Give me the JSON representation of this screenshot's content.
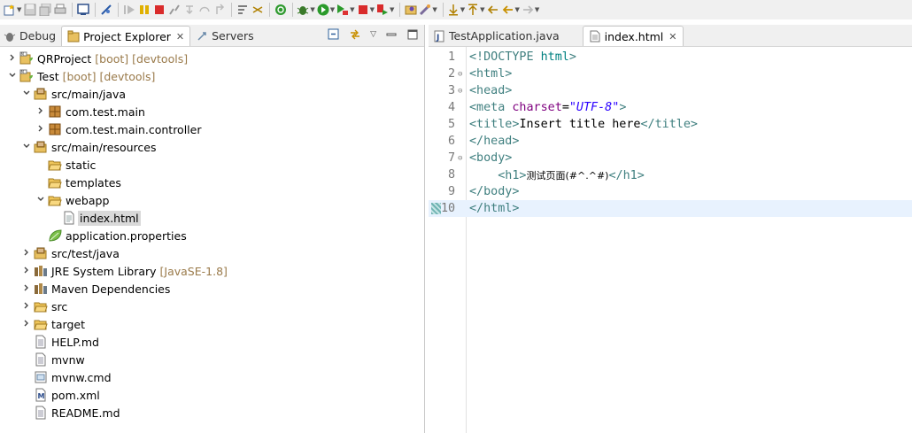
{
  "left_tabs": [
    {
      "label": "Debug",
      "icon": "debug-icon",
      "active": false
    },
    {
      "label": "Project Explorer",
      "icon": "project-explorer-icon",
      "active": true
    },
    {
      "label": "Servers",
      "icon": "servers-icon",
      "active": false
    }
  ],
  "left_close": "✕",
  "tree": [
    {
      "label": "QRProject",
      "deco": "[boot] [devtools]",
      "depth": 0,
      "twisty": ">",
      "icon": "boot-project-icon"
    },
    {
      "label": "Test",
      "deco": "[boot] [devtools]",
      "depth": 0,
      "twisty": "v",
      "icon": "boot-project-icon"
    },
    {
      "label": "src/main/java",
      "deco": "",
      "depth": 1,
      "twisty": "v",
      "icon": "source-folder-icon"
    },
    {
      "label": "com.test.main",
      "deco": "",
      "depth": 2,
      "twisty": ">",
      "icon": "package-icon"
    },
    {
      "label": "com.test.main.controller",
      "deco": "",
      "depth": 2,
      "twisty": ">",
      "icon": "package-icon"
    },
    {
      "label": "src/main/resources",
      "deco": "",
      "depth": 1,
      "twisty": "v",
      "icon": "source-folder-icon"
    },
    {
      "label": "static",
      "deco": "",
      "depth": 2,
      "twisty": "",
      "icon": "folder-icon"
    },
    {
      "label": "templates",
      "deco": "",
      "depth": 2,
      "twisty": "",
      "icon": "folder-icon"
    },
    {
      "label": "webapp",
      "deco": "",
      "depth": 2,
      "twisty": "v",
      "icon": "folder-icon"
    },
    {
      "label": "index.html",
      "deco": "",
      "depth": 3,
      "twisty": "",
      "icon": "html-file-icon",
      "selected": true
    },
    {
      "label": "application.properties",
      "deco": "",
      "depth": 2,
      "twisty": "",
      "icon": "spring-leaf-icon"
    },
    {
      "label": "src/test/java",
      "deco": "",
      "depth": 1,
      "twisty": ">",
      "icon": "source-folder-icon"
    },
    {
      "label": "JRE System Library",
      "deco": "[JavaSE-1.8]",
      "depth": 1,
      "twisty": ">",
      "icon": "library-icon"
    },
    {
      "label": "Maven Dependencies",
      "deco": "",
      "depth": 1,
      "twisty": ">",
      "icon": "library-icon"
    },
    {
      "label": "src",
      "deco": "",
      "depth": 1,
      "twisty": ">",
      "icon": "folder-icon"
    },
    {
      "label": "target",
      "deco": "",
      "depth": 1,
      "twisty": ">",
      "icon": "folder-icon"
    },
    {
      "label": "HELP.md",
      "deco": "",
      "depth": 1,
      "twisty": "",
      "icon": "text-file-icon"
    },
    {
      "label": "mvnw",
      "deco": "",
      "depth": 1,
      "twisty": "",
      "icon": "text-file-icon"
    },
    {
      "label": "mvnw.cmd",
      "deco": "",
      "depth": 1,
      "twisty": "",
      "icon": "cmd-file-icon"
    },
    {
      "label": "pom.xml",
      "deco": "",
      "depth": 1,
      "twisty": "",
      "icon": "maven-pom-icon"
    },
    {
      "label": "README.md",
      "deco": "",
      "depth": 1,
      "twisty": "",
      "icon": "text-file-icon"
    }
  ],
  "editor_tabs": [
    {
      "label": "TestApplication.java",
      "icon": "java-file-icon",
      "active": false
    },
    {
      "label": "index.html",
      "icon": "html-file-icon",
      "active": true
    }
  ],
  "editor_close": "✕",
  "code_lines": [
    {
      "n": "1",
      "fold": "",
      "segs": [
        [
          "tag",
          "<!DOCTYPE "
        ],
        [
          "doc",
          "html"
        ],
        [
          "tag",
          ">"
        ]
      ]
    },
    {
      "n": "2",
      "fold": "⊖",
      "segs": [
        [
          "tag",
          "<html>"
        ]
      ]
    },
    {
      "n": "3",
      "fold": "⊖",
      "segs": [
        [
          "tag",
          "<head>"
        ]
      ]
    },
    {
      "n": "4",
      "fold": "",
      "segs": [
        [
          "tag",
          "<meta "
        ],
        [
          "attr",
          "charset"
        ],
        [
          "txt",
          "="
        ],
        [
          "str",
          "\"UTF-8\""
        ],
        [
          "tag",
          ">"
        ]
      ]
    },
    {
      "n": "5",
      "fold": "",
      "segs": [
        [
          "tag",
          "<title>"
        ],
        [
          "txt",
          "Insert title here"
        ],
        [
          "tag",
          "</title>"
        ]
      ]
    },
    {
      "n": "6",
      "fold": "",
      "segs": [
        [
          "tag",
          "</head>"
        ]
      ]
    },
    {
      "n": "7",
      "fold": "⊖",
      "segs": [
        [
          "tag",
          "<body>"
        ]
      ]
    },
    {
      "n": "8",
      "fold": "",
      "segs": [
        [
          "txt",
          "    "
        ],
        [
          "tag",
          "<h1>"
        ],
        [
          "cn",
          "测试页面(#^.^#)"
        ],
        [
          "tag",
          "</h1>"
        ]
      ]
    },
    {
      "n": "9",
      "fold": "",
      "segs": [
        [
          "tag",
          "</body>"
        ]
      ]
    },
    {
      "n": "10",
      "fold": "",
      "segs": [
        [
          "tag",
          "</html>"
        ]
      ],
      "current": true
    }
  ]
}
